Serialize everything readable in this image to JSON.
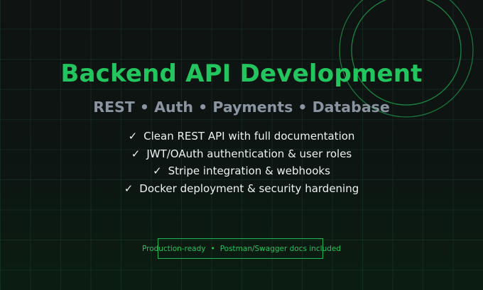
{
  "banner": {
    "title": "Backend API Development",
    "subtitle": "REST • Auth • Payments • Database",
    "check_mark": "✓",
    "features": [
      "Clean REST API with full documentation",
      "JWT/OAuth authentication & user roles",
      "Stripe integration & webhooks",
      "Docker deployment & security hardening"
    ],
    "footer": {
      "left": "Production-ready",
      "separator": "•",
      "right": "Postman/Swagger docs included"
    }
  },
  "colors": {
    "accent": "#22c55e",
    "subtitle": "#8b95a1",
    "text": "#eef1f3",
    "background": "#0f1312"
  }
}
